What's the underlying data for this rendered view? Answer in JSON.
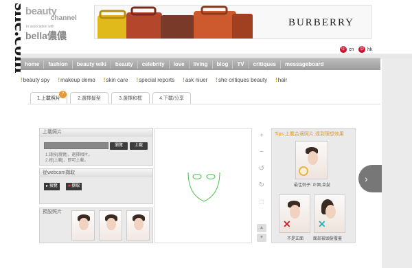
{
  "brand": {
    "vertical_logo": "she.com",
    "channel_line1": "beauty",
    "channel_line2": "channel",
    "partner_small": "In association with",
    "partner_name": "bella儂儂"
  },
  "ad": {
    "brand": "BURBERRY"
  },
  "lang": {
    "cn": "cn",
    "hk": "hk"
  },
  "nav": {
    "items": [
      "home",
      "fashion",
      "beauty wiki",
      "beauty",
      "celebrity",
      "love",
      "living",
      "blog",
      "TV",
      "critiques",
      "messageboard"
    ]
  },
  "subnav": {
    "items": [
      "beauty spy",
      "makeup demo",
      "skin care",
      "special reports",
      "ask niuer",
      "she critiques beauty",
      "hair"
    ]
  },
  "steps": [
    {
      "label": "1.上載照片",
      "active": true,
      "badge": "?"
    },
    {
      "label": "2.選擇髮型"
    },
    {
      "label": "3.選擇和框"
    },
    {
      "label": "4.下載/分享"
    }
  ],
  "upload": {
    "title": "上載照片",
    "browse": "瀏覽",
    "upload": "上載",
    "note1": "1.請按[瀏覽]，選擇相片。",
    "note2": "2.按[上載]，即可上載。"
  },
  "webcam": {
    "title": "從webcam擷取",
    "preview": "預覽",
    "capture": "擷取"
  },
  "presets": {
    "title": "預設照片"
  },
  "tips": {
    "title": "Tips:上載合適照片,達到理想效果",
    "cap_good": "最佳例子: 正面,束髮",
    "cap_bad1": "不是正面",
    "cap_bad2": "面部被頭髮覆蓋"
  },
  "colors": {
    "accent": "#e09a2a",
    "nav_bg": "#a8a8a8",
    "guide": "#4ec24e",
    "bad": "#c0282c",
    "bad2": "#2bb0b8"
  }
}
